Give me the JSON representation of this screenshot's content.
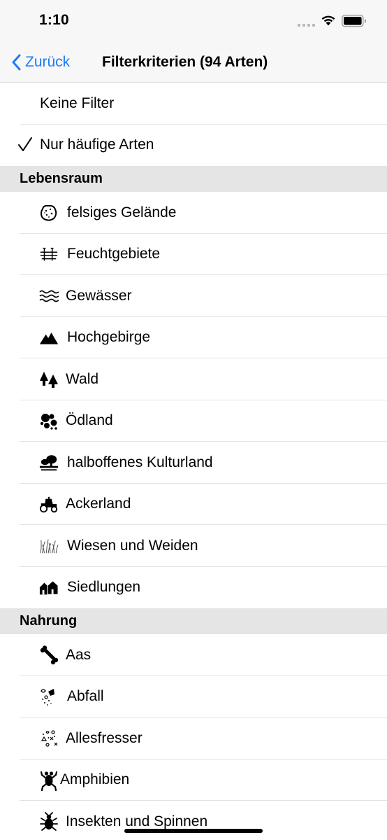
{
  "status": {
    "time": "1:10"
  },
  "nav": {
    "back_label": "Zurück",
    "title": "Filterkriterien (94 Arten)"
  },
  "filters": {
    "none": "Keine Filter",
    "common_only": "Nur häufige Arten"
  },
  "sections": {
    "habitat": {
      "title": "Lebensraum",
      "items": [
        {
          "label": "felsiges Gelände",
          "icon": "rock-icon"
        },
        {
          "label": "Feuchtgebiete",
          "icon": "wetland-icon"
        },
        {
          "label": "Gewässer",
          "icon": "water-icon"
        },
        {
          "label": "Hochgebirge",
          "icon": "mountain-icon"
        },
        {
          "label": "Wald",
          "icon": "forest-icon"
        },
        {
          "label": "Ödland",
          "icon": "wasteland-icon"
        },
        {
          "label": "halboffenes Kulturland",
          "icon": "farmland-tree-icon"
        },
        {
          "label": "Ackerland",
          "icon": "tractor-icon"
        },
        {
          "label": "Wiesen und Weiden",
          "icon": "grass-icon"
        },
        {
          "label": "Siedlungen",
          "icon": "houses-icon"
        }
      ]
    },
    "food": {
      "title": "Nahrung",
      "items": [
        {
          "label": "Aas",
          "icon": "bone-icon"
        },
        {
          "label": "Abfall",
          "icon": "trash-icon"
        },
        {
          "label": "Allesfresser",
          "icon": "omnivore-icon"
        },
        {
          "label": "Amphibien",
          "icon": "frog-icon"
        },
        {
          "label": "Insekten und Spinnen",
          "icon": "beetle-icon"
        }
      ]
    }
  }
}
